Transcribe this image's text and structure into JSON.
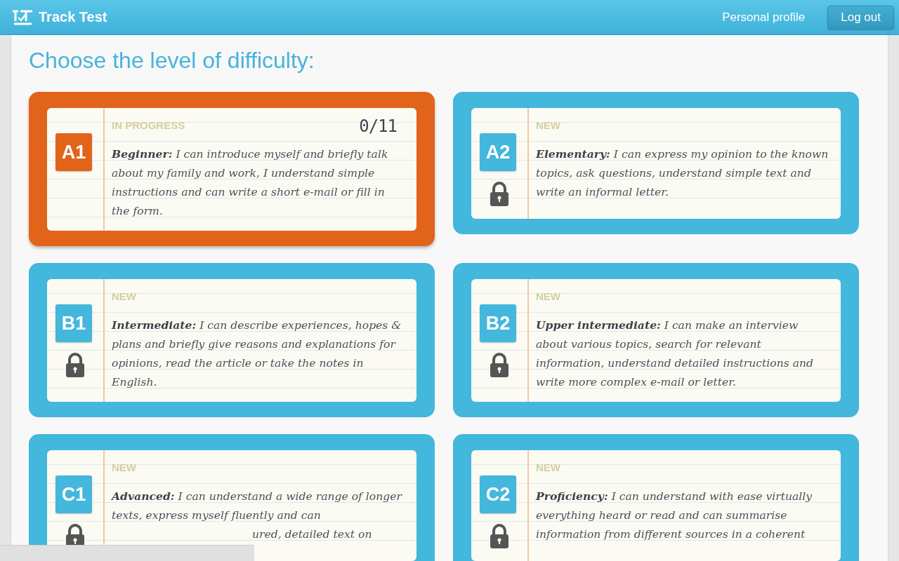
{
  "header": {
    "app_name": "Track Test",
    "links": [
      "Personal profile"
    ],
    "logout_button": "Log out"
  },
  "title": "Choose the level of difficulty:",
  "levels": [
    {
      "code": "A1",
      "current": true,
      "locked": false,
      "status": "IN PROGRESS",
      "progress": "0/11",
      "description": "**Beginner:** I can introduce myself and briefly talk about my family and work, I understand simple instructions and can write a short e-mail or fill in the form."
    },
    {
      "code": "A2",
      "current": false,
      "locked": true,
      "status": "NEW",
      "description": "**Elementary:** I can express my opinion to the known topics, ask questions, understand simple text and write an informal letter."
    },
    {
      "code": "B1",
      "current": false,
      "locked": true,
      "status": "NEW",
      "description": "**Intermediate:** I can describe experiences, hopes & plans and briefly give reasons and explanations for opinions, read the article or take the notes in English."
    },
    {
      "code": "B2",
      "current": false,
      "locked": true,
      "status": "NEW",
      "description": "**Upper intermediate:** I can make an interview about various topics, search for relevant information, understand detailed instructions and write more complex e-mail or letter."
    },
    {
      "code": "C1",
      "current": false,
      "locked": true,
      "status": "NEW",
      "description": "**Advanced:** I can understand a wide range of longer texts, express myself fluently and can",
      "tail": "ured, detailed text on"
    },
    {
      "code": "C2",
      "current": false,
      "locked": true,
      "status": "NEW",
      "description": "**Proficiency:** I can understand with ease virtually everything heard or read and can summarise information from different sources in a coherent"
    }
  ]
}
